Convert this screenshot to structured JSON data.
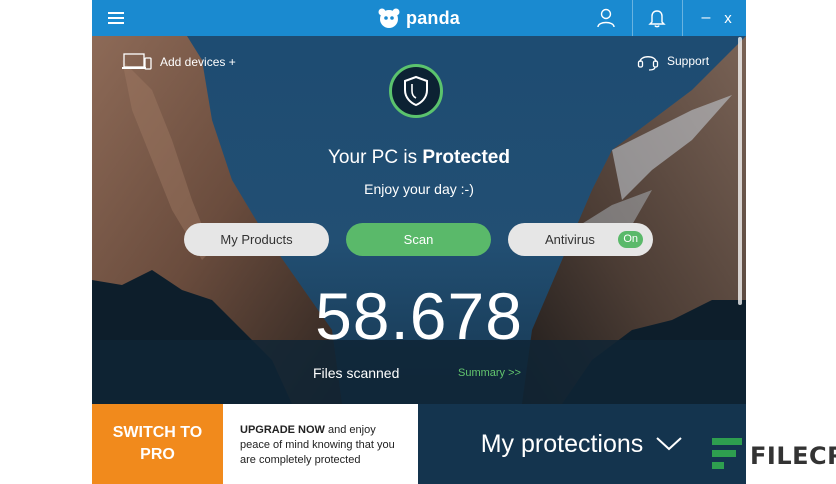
{
  "app": {
    "brand": "panda",
    "accent": "#1a8ad0"
  },
  "titlebar": {
    "menu_icon": "hamburger-icon",
    "user_icon": "user-icon",
    "notify_icon": "bell-icon",
    "minimize": "–",
    "close": "x"
  },
  "top": {
    "add_devices": "Add devices +",
    "support": "Support"
  },
  "status": {
    "prefix": "Your PC is",
    "state": "Protected",
    "subtitle": "Enjoy your day :-)"
  },
  "buttons": {
    "my_products": "My Products",
    "scan": "Scan",
    "antivirus": "Antivirus",
    "antivirus_state": "On"
  },
  "stats": {
    "files_scanned_count": "58.678",
    "files_scanned_label": "Files scanned",
    "summary_link": "Summary >>"
  },
  "bottom": {
    "switch_line1": "SWITCH TO",
    "switch_line2": "PRO",
    "upgrade_bold": "UPGRADE NOW",
    "upgrade_rest": " and enjoy peace of mind knowing that you are completely protected",
    "my_protections": "My protections"
  },
  "watermark": {
    "text": "FILECR"
  },
  "colors": {
    "protected_green": "#5bc36d",
    "switch_orange": "#f18a1c",
    "scan_green": "#5ab96a"
  }
}
